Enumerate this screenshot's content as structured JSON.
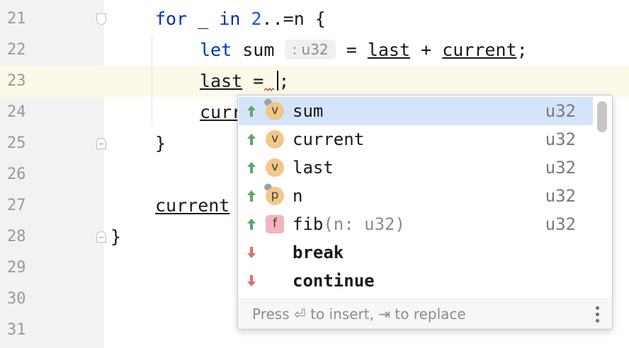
{
  "editor": {
    "line_numbers": [
      "21",
      "22",
      "23",
      "24",
      "25",
      "26",
      "27",
      "28",
      "29",
      "30",
      "31"
    ],
    "line21": {
      "kw_for": "for",
      "mid": " _ ",
      "kw_in": "in",
      "num": "2",
      "rest": "..=n {"
    },
    "line22": {
      "kw_let": "let",
      "var": "sum",
      "hint": ": u32",
      "eq": " = ",
      "a": "last",
      "op": " + ",
      "b": "current",
      "end": ";"
    },
    "line23": {
      "var": "last",
      "eq": " = ",
      "end": ";"
    },
    "line24": {
      "partial": "curr"
    },
    "line25": {
      "text": "}"
    },
    "line27": {
      "var": "current"
    },
    "line28": {
      "text": "}"
    }
  },
  "completion": {
    "items": [
      {
        "icon": "v",
        "label": "sum",
        "type": "u32",
        "direction": "up"
      },
      {
        "icon": "v",
        "label": "current",
        "type": "u32",
        "direction": "up"
      },
      {
        "icon": "v",
        "label": "last",
        "type": "u32",
        "direction": "up"
      },
      {
        "icon": "p",
        "label": "n",
        "type": "u32",
        "direction": "up"
      },
      {
        "icon": "f",
        "label": "fib",
        "signature": "(n: u32)",
        "type": "u32",
        "direction": "up"
      },
      {
        "label": "break",
        "direction": "down"
      },
      {
        "label": "continue",
        "direction": "down"
      }
    ],
    "footer": "Press ⏎ to insert, ⇥ to replace"
  },
  "colors": {
    "keyword": "#0033b3",
    "number": "#1750eb",
    "arrow_up": "#59a869",
    "arrow_down": "#e06c75",
    "selection": "#d4e4fb",
    "current_line": "#fcf9e8"
  }
}
